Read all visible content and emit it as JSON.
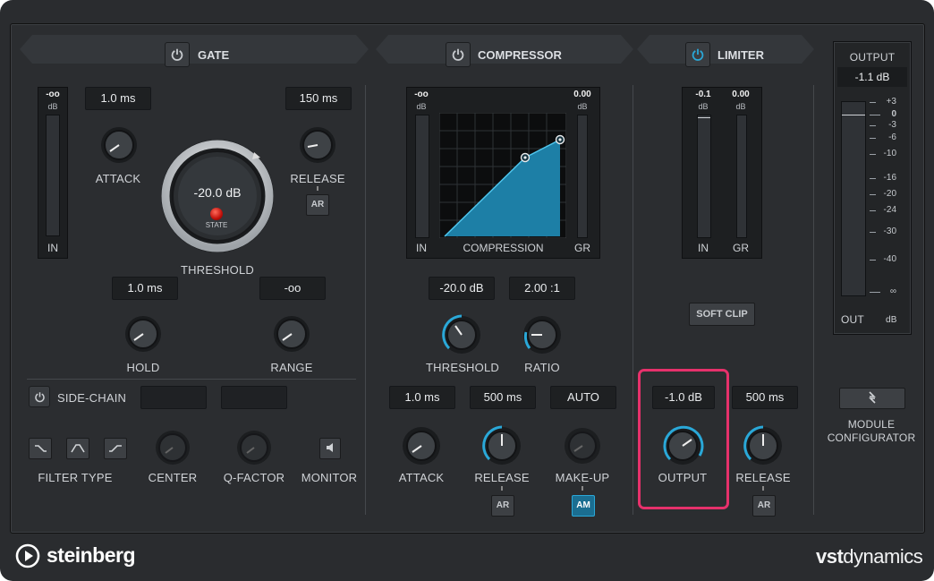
{
  "gate": {
    "title": "GATE",
    "in_meter": {
      "value": "-oo",
      "unit": "dB",
      "label": "IN"
    },
    "attack": {
      "value": "1.0 ms",
      "label": "ATTACK"
    },
    "release": {
      "value": "150 ms",
      "label": "RELEASE",
      "ar_label": "AR"
    },
    "threshold": {
      "value": "-20.0 dB",
      "label": "THRESHOLD",
      "state_label": "STATE"
    },
    "hold": {
      "value": "1.0 ms",
      "label": "HOLD"
    },
    "range": {
      "value": "-oo",
      "label": "RANGE"
    },
    "sidechain": {
      "label": "SIDE-CHAIN"
    },
    "filter_type_label": "FILTER TYPE",
    "center_label": "CENTER",
    "qfactor_label": "Q-FACTOR",
    "monitor_label": "MONITOR"
  },
  "compressor": {
    "title": "COMPRESSOR",
    "in_meter": {
      "value": "-oo",
      "unit": "dB",
      "label": "IN"
    },
    "gr_meter": {
      "value": "0.00",
      "unit": "dB",
      "label": "GR"
    },
    "graph_label": "COMPRESSION",
    "threshold": {
      "value": "-20.0 dB",
      "label": "THRESHOLD"
    },
    "ratio": {
      "value": "2.00 :1",
      "label": "RATIO"
    },
    "attack": {
      "value": "1.0 ms",
      "label": "ATTACK"
    },
    "release": {
      "value": "500 ms",
      "label": "RELEASE",
      "ar_label": "AR"
    },
    "makeup": {
      "value": "AUTO",
      "label": "MAKE-UP",
      "am_label": "AM"
    }
  },
  "limiter": {
    "title": "LIMITER",
    "in_meter": {
      "value": "-0.1",
      "unit": "dB",
      "label": "IN"
    },
    "gr_meter": {
      "value": "0.00",
      "unit": "dB",
      "label": "GR"
    },
    "soft_clip_label": "SOFT CLIP",
    "output": {
      "value": "-1.0 dB",
      "label": "OUTPUT"
    },
    "release": {
      "value": "500 ms",
      "label": "RELEASE",
      "ar_label": "AR"
    }
  },
  "output_meter": {
    "title": "OUTPUT",
    "value": "-1.1 dB",
    "out_label": "OUT",
    "unit_label": "dB",
    "scale": [
      "+3",
      "0",
      "-3",
      "-6",
      "-10",
      "-16",
      "-20",
      "-24",
      "-30",
      "-40",
      "∞"
    ]
  },
  "module_configurator": {
    "line1": "MODULE",
    "line2": "CONFIGURATOR"
  },
  "footer": {
    "brand": "steinberg",
    "product_bold": "vst",
    "product_light": "dynamics"
  },
  "colors": {
    "accent": "#2aa8d8",
    "highlight": "#e6316b",
    "panel": "#2b2d30"
  }
}
